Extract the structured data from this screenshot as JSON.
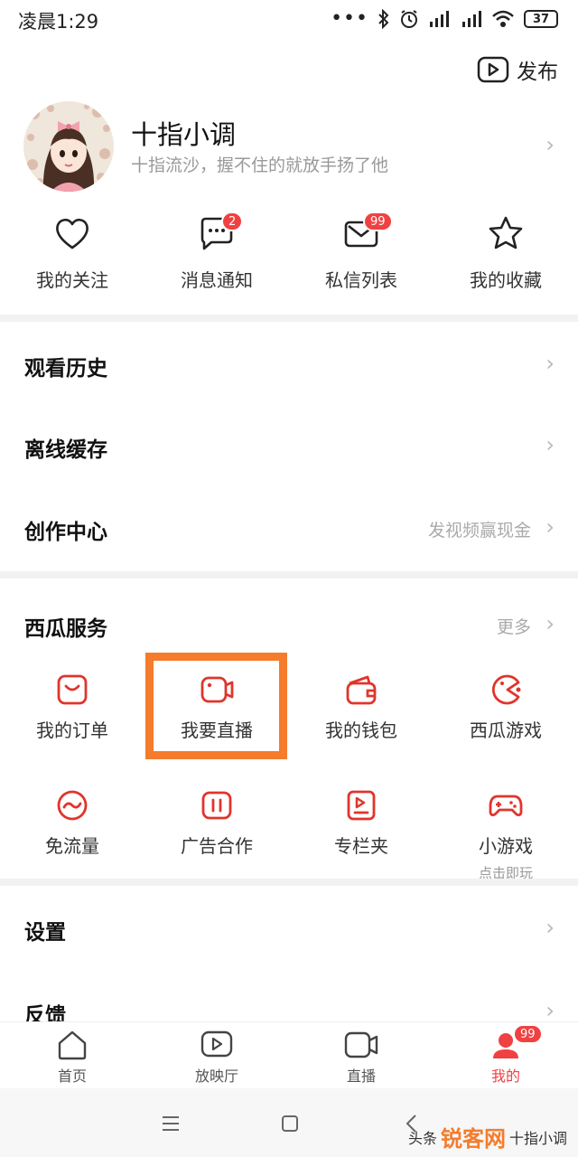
{
  "status_bar": {
    "time": "凌晨1:29",
    "battery": "37"
  },
  "header": {
    "publish_label": "发布"
  },
  "profile": {
    "name": "十指小调",
    "signature": "十指流沙，握不住的就放手扬了他"
  },
  "quick_actions": [
    {
      "label": "我的关注",
      "icon": "heart-icon"
    },
    {
      "label": "消息通知",
      "icon": "chat-bubble-icon",
      "badge": "2"
    },
    {
      "label": "私信列表",
      "icon": "mail-icon",
      "badge": "99"
    },
    {
      "label": "我的收藏",
      "icon": "star-icon"
    }
  ],
  "menu": [
    {
      "label": "观看历史"
    },
    {
      "label": "离线缓存"
    },
    {
      "label": "创作中心",
      "hint": "发视频赢现金"
    }
  ],
  "services": {
    "title": "西瓜服务",
    "more": "更多",
    "items": [
      {
        "label": "我的订单",
        "icon": "order-icon"
      },
      {
        "label": "我要直播",
        "icon": "camera-icon"
      },
      {
        "label": "我的钱包",
        "icon": "wallet-icon"
      },
      {
        "label": "西瓜游戏",
        "icon": "pacman-icon"
      },
      {
        "label": "免流量",
        "icon": "wave-icon"
      },
      {
        "label": "广告合作",
        "icon": "ad-icon"
      },
      {
        "label": "专栏夹",
        "icon": "column-icon"
      },
      {
        "label": "小游戏",
        "sub": "点击即玩",
        "icon": "gamepad-icon"
      }
    ]
  },
  "settings": [
    {
      "label": "设置"
    },
    {
      "label": "反馈"
    }
  ],
  "tabbar": {
    "items": [
      {
        "label": "首页",
        "icon": "home-icon"
      },
      {
        "label": "放映厅",
        "icon": "play-screen-icon"
      },
      {
        "label": "直播",
        "icon": "video-camera-icon"
      },
      {
        "label": "我的",
        "icon": "user-icon",
        "badge": "99",
        "active": true
      }
    ]
  },
  "watermark": {
    "prefix": "头条",
    "site": "锐客网",
    "suffix": "十指小调"
  },
  "colors": {
    "accent": "#f04142",
    "highlight": "#f47c2c"
  }
}
